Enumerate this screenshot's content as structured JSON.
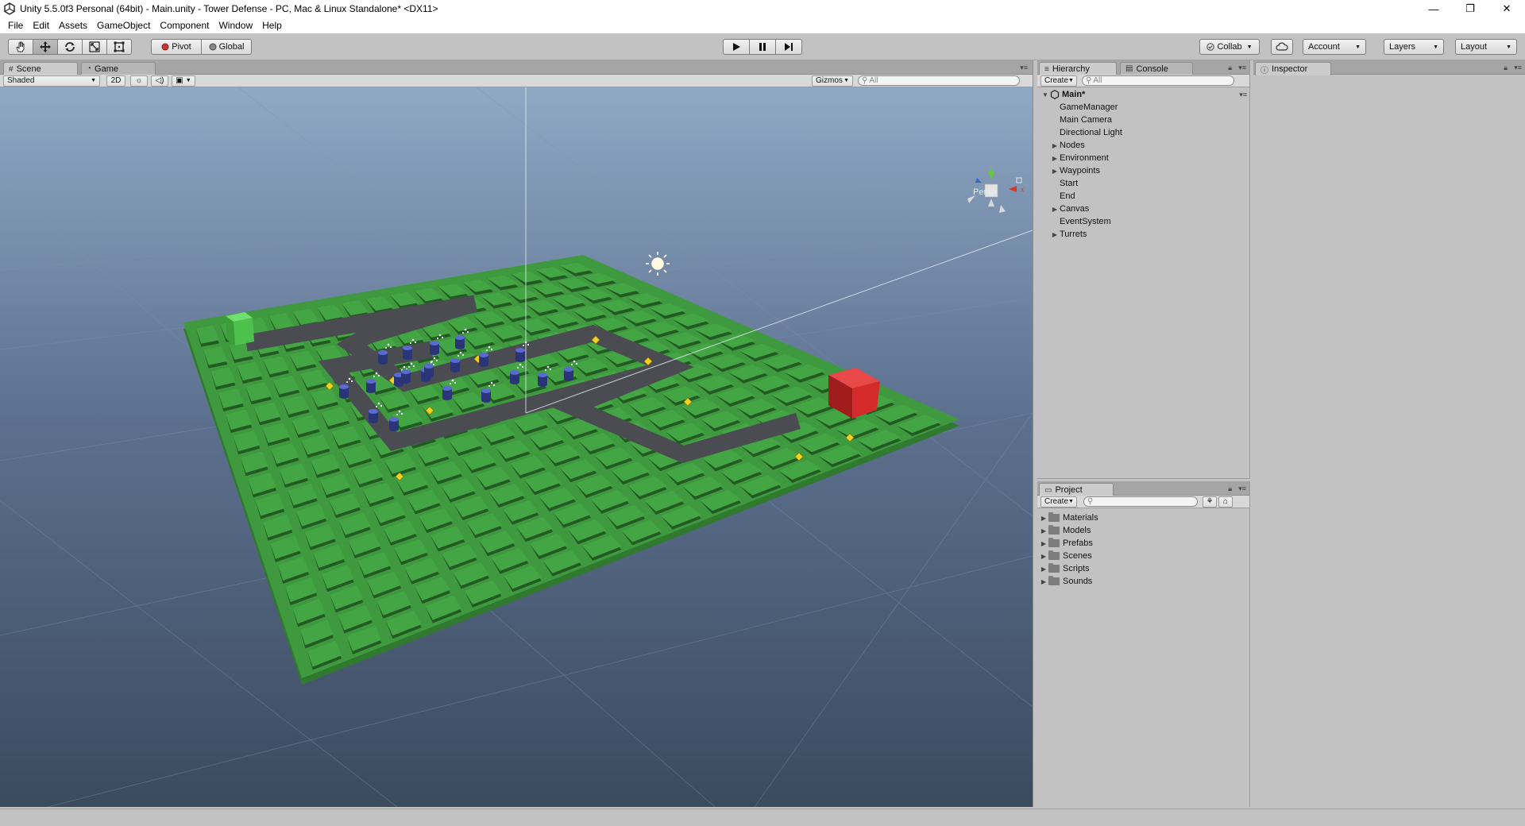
{
  "window": {
    "title": "Unity 5.5.0f3 Personal (64bit) - Main.unity - Tower Defense - PC, Mac & Linux Standalone* <DX11>",
    "minimize": "—",
    "maximize": "❐",
    "close": "✕"
  },
  "menu": [
    "File",
    "Edit",
    "Assets",
    "GameObject",
    "Component",
    "Window",
    "Help"
  ],
  "toolbar": {
    "pivot": "Pivot",
    "global": "Global",
    "collab": "Collab",
    "account": "Account",
    "layers": "Layers",
    "layout": "Layout"
  },
  "scene": {
    "tabs": [
      "Scene",
      "Game"
    ],
    "shading_mode": "Shaded",
    "mode_2d": "2D",
    "gizmos": "Gizmos",
    "search_placeholder": "All",
    "projection": "Persp",
    "colors": {
      "sky_top": "#8fa8c4",
      "sky_bottom": "#3c4a5e",
      "ground": "#3f9a3f",
      "path": "#4a4c52",
      "start_cube": "#4cc24c",
      "end_cube": "#d42a2a",
      "waypoint": "#f2d21e",
      "turret": "#3a4aa8"
    }
  },
  "hierarchy": {
    "tab": "Hierarchy",
    "console_tab": "Console",
    "create": "Create",
    "search_placeholder": "All",
    "scene_name": "Main*",
    "items": [
      {
        "label": "GameManager",
        "expandable": false
      },
      {
        "label": "Main Camera",
        "expandable": false
      },
      {
        "label": "Directional Light",
        "expandable": false
      },
      {
        "label": "Nodes",
        "expandable": true
      },
      {
        "label": "Environment",
        "expandable": true
      },
      {
        "label": "Waypoints",
        "expandable": true
      },
      {
        "label": "Start",
        "expandable": false
      },
      {
        "label": "End",
        "expandable": false
      },
      {
        "label": "Canvas",
        "expandable": true
      },
      {
        "label": "EventSystem",
        "expandable": false
      },
      {
        "label": "Turrets",
        "expandable": true
      }
    ]
  },
  "project": {
    "tab": "Project",
    "create": "Create",
    "folders": [
      "Materials",
      "Models",
      "Prefabs",
      "Scenes",
      "Scripts",
      "Sounds"
    ]
  },
  "inspector": {
    "tab": "Inspector"
  }
}
